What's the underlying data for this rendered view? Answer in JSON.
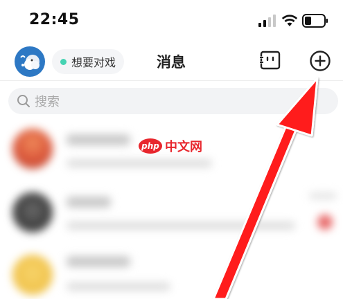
{
  "status_bar": {
    "time": "22:45",
    "icons": [
      "signal-icon",
      "wifi-icon",
      "battery-icon"
    ]
  },
  "header": {
    "avatar_icon": "avatar",
    "status_label": "想要对戏",
    "status_color": "#45d3b2",
    "title": "消息",
    "face_icon": "chat-face-icon",
    "add_icon": "add-circle-icon"
  },
  "search": {
    "placeholder": "搜索",
    "icon": "search-icon"
  },
  "watermark": {
    "logo_text": "php",
    "site_text": "中文网",
    "color": "#e8262d"
  },
  "annotation": {
    "arrow_color": "#ff1a1a"
  }
}
